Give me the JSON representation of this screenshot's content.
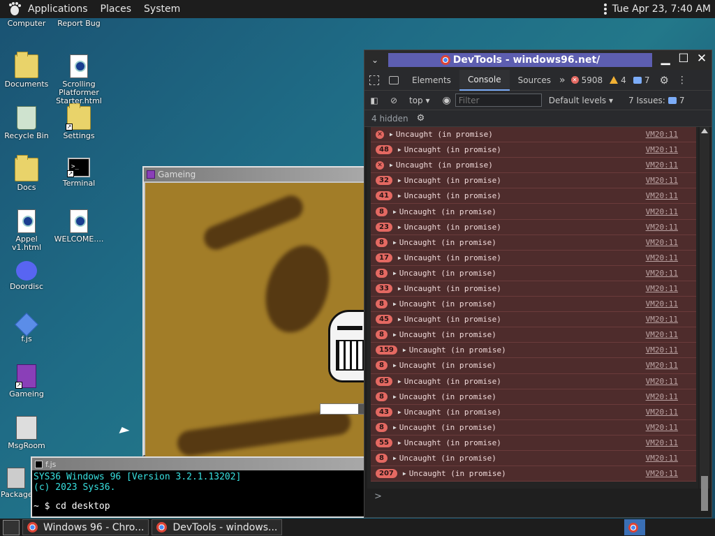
{
  "top_panel": {
    "menus": [
      "Applications",
      "Places",
      "System"
    ],
    "clock": "Tue Apr 23, 7:40 AM"
  },
  "desktop_icons": [
    {
      "label": "Computer",
      "icon": "computer-icon"
    },
    {
      "label": "Report Bug",
      "icon": "report-bug-icon"
    },
    {
      "label": "Documents",
      "icon": "folder-icon"
    },
    {
      "label": "Scrolling Platformer Starter.html",
      "icon": "html-doc-icon"
    },
    {
      "label": "Recycle Bin",
      "icon": "recycle-bin-icon"
    },
    {
      "label": "Settings",
      "icon": "settings-icon"
    },
    {
      "label": "Docs",
      "icon": "folder-icon"
    },
    {
      "label": "Terminal",
      "icon": "terminal-icon"
    },
    {
      "label": "Appel v1.html",
      "icon": "html-doc-icon"
    },
    {
      "label": "WELCOME....",
      "icon": "markdown-doc-icon"
    },
    {
      "label": "Doordisc",
      "icon": "discord-icon"
    },
    {
      "label": "f.js",
      "icon": "js-file-icon"
    },
    {
      "label": "Gameing",
      "icon": "cube-icon"
    },
    {
      "label": "MsgRoom",
      "icon": "msgroom-icon"
    },
    {
      "label": "Package Manager",
      "icon": "package-icon"
    }
  ],
  "gameing_window": {
    "title": "Gameing",
    "health_fraction": 0.85
  },
  "terminal_window": {
    "title": "f.js",
    "lines": [
      "SYS36 Windows 96 [Version 3.2.1.13202]",
      "(c) 2023 Sys36."
    ],
    "prompt": "~ $ cd desktop"
  },
  "devtools": {
    "title": "DevTools - windows96.net/",
    "tabs": [
      "Elements",
      "Console",
      "Sources"
    ],
    "active_tab": "Console",
    "error_count": "5908",
    "warning_count": "4",
    "info_count": "7",
    "context": "top",
    "filter_placeholder": "Filter",
    "levels": "Default levels",
    "issues_label": "7 Issues:",
    "issues_count": "7",
    "hidden": "4 hidden",
    "messages": [
      {
        "badge": "",
        "text": "Uncaught (in promise)",
        "source": "VM20:11"
      },
      {
        "badge": "48",
        "text": "Uncaught (in promise)",
        "source": "VM20:11"
      },
      {
        "badge": "",
        "text": "Uncaught (in promise)",
        "source": "VM20:11"
      },
      {
        "badge": "32",
        "text": "Uncaught (in promise)",
        "source": "VM20:11"
      },
      {
        "badge": "41",
        "text": "Uncaught (in promise)",
        "source": "VM20:11"
      },
      {
        "badge": "8",
        "text": "Uncaught (in promise)",
        "source": "VM20:11"
      },
      {
        "badge": "23",
        "text": "Uncaught (in promise)",
        "source": "VM20:11"
      },
      {
        "badge": "8",
        "text": "Uncaught (in promise)",
        "source": "VM20:11"
      },
      {
        "badge": "17",
        "text": "Uncaught (in promise)",
        "source": "VM20:11"
      },
      {
        "badge": "8",
        "text": "Uncaught (in promise)",
        "source": "VM20:11"
      },
      {
        "badge": "33",
        "text": "Uncaught (in promise)",
        "source": "VM20:11"
      },
      {
        "badge": "8",
        "text": "Uncaught (in promise)",
        "source": "VM20:11"
      },
      {
        "badge": "45",
        "text": "Uncaught (in promise)",
        "source": "VM20:11"
      },
      {
        "badge": "8",
        "text": "Uncaught (in promise)",
        "source": "VM20:11"
      },
      {
        "badge": "159",
        "text": "Uncaught (in promise)",
        "source": "VM20:11"
      },
      {
        "badge": "8",
        "text": "Uncaught (in promise)",
        "source": "VM20:11"
      },
      {
        "badge": "65",
        "text": "Uncaught (in promise)",
        "source": "VM20:11"
      },
      {
        "badge": "8",
        "text": "Uncaught (in promise)",
        "source": "VM20:11"
      },
      {
        "badge": "43",
        "text": "Uncaught (in promise)",
        "source": "VM20:11"
      },
      {
        "badge": "8",
        "text": "Uncaught (in promise)",
        "source": "VM20:11"
      },
      {
        "badge": "55",
        "text": "Uncaught (in promise)",
        "source": "VM20:11"
      },
      {
        "badge": "8",
        "text": "Uncaught (in promise)",
        "source": "VM20:11"
      },
      {
        "badge": "207",
        "text": "Uncaught (in promise)",
        "source": "VM20:11"
      }
    ],
    "console_prompt": ">"
  },
  "taskbar": {
    "items": [
      "Windows 96 - Chro...",
      "DevTools - windows..."
    ]
  }
}
